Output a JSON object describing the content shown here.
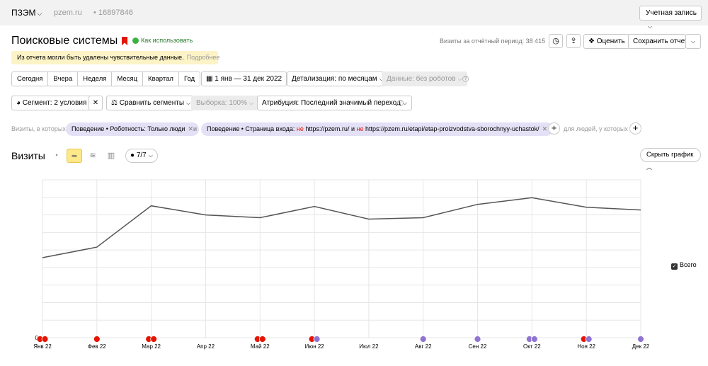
{
  "topbar": {
    "counter_name": "ПЗЭМ",
    "site": "pzem.ru",
    "counter_id": "16897846",
    "account_button": "Учетная запись"
  },
  "header": {
    "title": "Поисковые системы",
    "help_link": "Как использовать",
    "visits_period": "Визиты за отчётный период: 38 415",
    "rate_button": "Оценить",
    "save_button": "Сохранить отчет"
  },
  "notice": {
    "text": "Из отчета могли быть удалены чувствительные данные.",
    "more": "Подробнее"
  },
  "period": {
    "buttons": [
      "Сегодня",
      "Вчера",
      "Неделя",
      "Месяц",
      "Квартал",
      "Год"
    ],
    "range": "1 янв — 31 дек 2022",
    "detail": "Детализация: по месяцам",
    "data_filter": "Данные: без роботов"
  },
  "segment": {
    "segment_button": "Сегмент: 2 условия",
    "compare_button": "Сравнить сегменты",
    "sampling": "Выборка: 100%",
    "attribution": "Атрибуция: Последний значимый переход"
  },
  "conditions": {
    "label": "Визиты, в которых",
    "chip1": "Поведение • Роботность: Только люди",
    "and": "и",
    "chip2_prefix": "Поведение • Страница входа: ",
    "chip2_not1": "не",
    "chip2_url1": " https://pzem.ru/",
    "chip2_and": " и ",
    "chip2_not2": "не",
    "chip2_url2": " https://pzem.ru/etapi/etap-proizvodstva-sborochnyy-uchastok/",
    "for_people": "для людей, у которых"
  },
  "chart_section": {
    "title": "Визиты",
    "series_count": "7/7",
    "hide_button": "Скрыть график",
    "legend_label": "Всего"
  },
  "colors": {
    "line": "#555555",
    "grid": "#e6e6e6",
    "marker_red": "#e61400",
    "marker_purple": "#8f75d1"
  },
  "chart_data": {
    "type": "line",
    "categories": [
      "Янв 22",
      "Фев 22",
      "Мар 22",
      "Апр 22",
      "Май 22",
      "Июн 22",
      "Июл 22",
      "Авг 22",
      "Сен 22",
      "Окт 22",
      "Ноя 22",
      "Дек 22"
    ],
    "series": [
      {
        "name": "Всего",
        "values": [
          2280,
          2580,
          3760,
          3500,
          3420,
          3740,
          3380,
          3420,
          3800,
          3990,
          3720,
          3640
        ]
      }
    ],
    "ylim": [
      0,
      4500
    ],
    "yticks": [
      0,
      500,
      1000,
      1500,
      2000,
      2500,
      3000,
      3500,
      4000,
      4500
    ],
    "ytick_labels": [
      "0",
      "",
      "",
      "",
      "",
      "",
      "",
      "",
      "",
      ""
    ],
    "grid": true,
    "legend": "right",
    "event_markers": [
      {
        "x": "Янв 22",
        "types": [
          "red",
          "red"
        ]
      },
      {
        "x": "Фев 22",
        "types": [
          "red"
        ]
      },
      {
        "x": "Мар 22",
        "types": [
          "red",
          "red"
        ]
      },
      {
        "x": "Май 22",
        "types": [
          "red",
          "red"
        ]
      },
      {
        "x": "Июн 22",
        "types": [
          "red",
          "purple"
        ]
      },
      {
        "x": "Авг 22",
        "types": [
          "purple"
        ]
      },
      {
        "x": "Сен 22",
        "types": [
          "purple"
        ]
      },
      {
        "x": "Окт 22",
        "types": [
          "purple",
          "purple"
        ]
      },
      {
        "x": "Ноя 22",
        "types": [
          "red",
          "purple"
        ]
      },
      {
        "x": "Дек 22",
        "types": [
          "purple"
        ]
      }
    ]
  }
}
